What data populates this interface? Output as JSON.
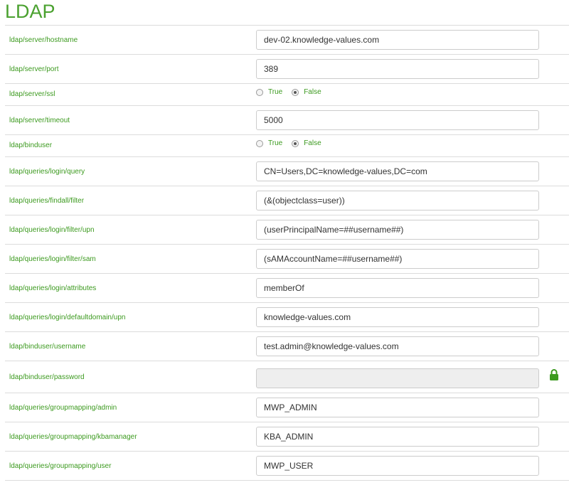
{
  "page": {
    "title": "LDAP"
  },
  "settings": [
    {
      "key": "ldap/server/hostname",
      "type": "text",
      "value": "dev-02.knowledge-values.com"
    },
    {
      "key": "ldap/server/port",
      "type": "text",
      "value": "389"
    },
    {
      "key": "ldap/server/ssl",
      "type": "radio",
      "options": [
        "True",
        "False"
      ],
      "selected": "False"
    },
    {
      "key": "ldap/server/timeout",
      "type": "text",
      "value": "5000"
    },
    {
      "key": "ldap/binduser",
      "type": "radio",
      "options": [
        "True",
        "False"
      ],
      "selected": "False"
    },
    {
      "key": "ldap/queries/login/query",
      "type": "text",
      "value": "CN=Users,DC=knowledge-values,DC=com"
    },
    {
      "key": "ldap/queries/findall/filter",
      "type": "text",
      "value": "(&(objectclass=user))"
    },
    {
      "key": "ldap/queries/login/filter/upn",
      "type": "text",
      "value": "(userPrincipalName=##username##)"
    },
    {
      "key": "ldap/queries/login/filter/sam",
      "type": "text",
      "value": "(sAMAccountName=##username##)"
    },
    {
      "key": "ldap/queries/login/attributes",
      "type": "text",
      "value": "memberOf"
    },
    {
      "key": "ldap/queries/login/defaultdomain/upn",
      "type": "text",
      "value": "knowledge-values.com"
    },
    {
      "key": "ldap/binduser/username",
      "type": "text",
      "value": "test.admin@knowledge-values.com"
    },
    {
      "key": "ldap/binduser/password",
      "type": "password",
      "value": "",
      "locked": true,
      "icon": "lock-icon"
    },
    {
      "key": "ldap/queries/groupmapping/admin",
      "type": "text",
      "value": "MWP_ADMIN"
    },
    {
      "key": "ldap/queries/groupmapping/kbamanager",
      "type": "text",
      "value": "KBA_ADMIN"
    },
    {
      "key": "ldap/queries/groupmapping/user",
      "type": "text",
      "value": "MWP_USER"
    }
  ],
  "colors": {
    "accent": "#4aa12f",
    "label": "#3c9a1f",
    "border": "#dcdcdc",
    "disabled_input": "#eeeeee"
  }
}
